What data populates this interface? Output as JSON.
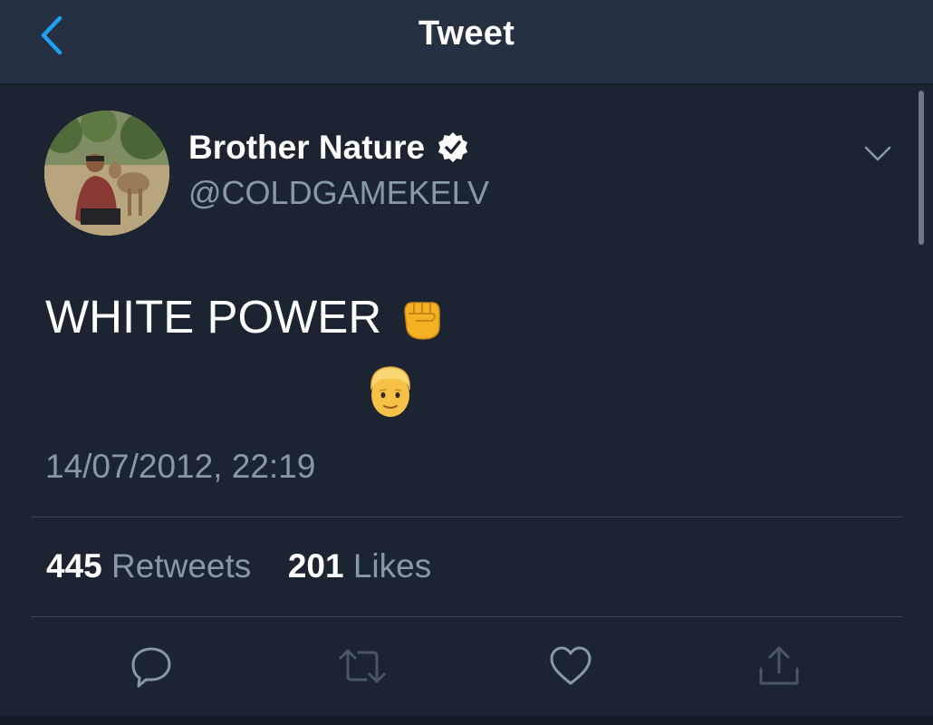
{
  "nav": {
    "title": "Tweet"
  },
  "tweet": {
    "author": {
      "display_name": "Brother Nature",
      "handle": "@COLDGAMEKELV",
      "verified": true
    },
    "text": "WHITE POWER",
    "emojis": [
      "raised-fist-icon",
      "boy-face-icon"
    ],
    "timestamp": "14/07/2012, 22:19",
    "stats": {
      "retweets_count": "445",
      "retweets_label": "Retweets",
      "likes_count": "201",
      "likes_label": "Likes"
    },
    "actions": [
      "reply-icon",
      "retweet-icon",
      "like-icon",
      "share-icon"
    ]
  },
  "colors": {
    "background": "#1c2431",
    "navbar": "#253142",
    "accent": "#1da1f2",
    "secondary_text": "#8899a6",
    "divider": "#3a4657"
  }
}
